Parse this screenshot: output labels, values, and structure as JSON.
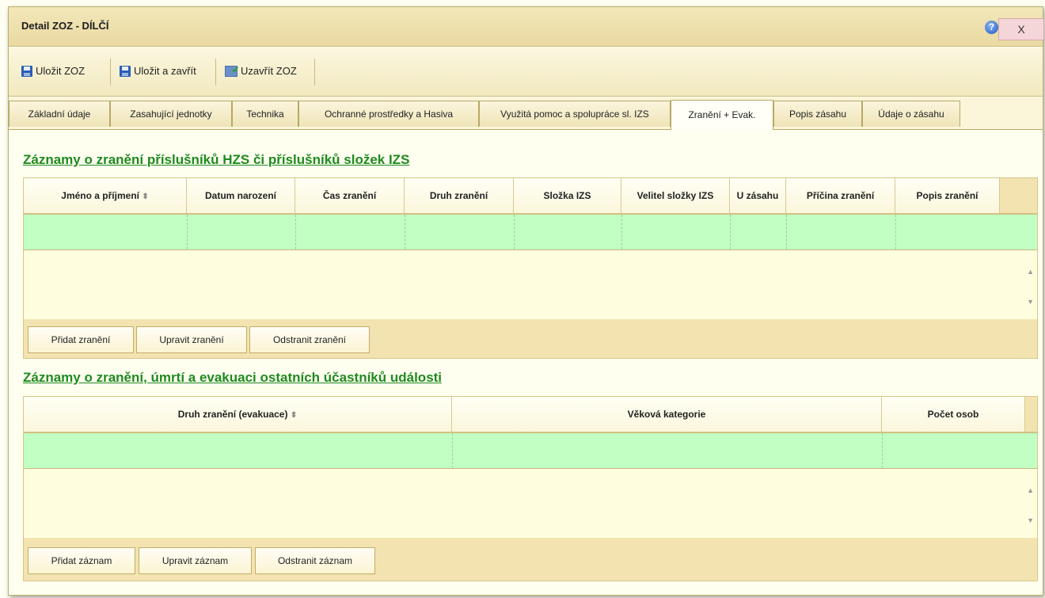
{
  "window": {
    "title": "Detail ZOZ - DÍLČÍ",
    "help_glyph": "?",
    "close_label": "X"
  },
  "toolbar": {
    "save_label": "Uložit ZOZ",
    "save_close_label": "Uložit a zavřít",
    "finish_label": "Uzavřít ZOZ"
  },
  "tabs": [
    {
      "label": "Základní údaje"
    },
    {
      "label": "Zasahující jednotky"
    },
    {
      "label": "Technika"
    },
    {
      "label": "Ochranné prostředky a Hasiva"
    },
    {
      "label": "Využitá pomoc a spolupráce sl. IZS"
    },
    {
      "label": "Zranění + Evak.",
      "active": true
    },
    {
      "label": "Popis zásahu"
    },
    {
      "label": "Údaje o zásahu"
    }
  ],
  "section1": {
    "title": "Záznamy o zranění příslušníků HZS či příslušníků složek IZS",
    "columns": [
      "Jméno a příjmení",
      "Datum narození",
      "Čas zranění",
      "Druh zranění",
      "Složka IZS",
      "Velitel složky IZS",
      "U zásahu",
      "Příčina zranění",
      "Popis zranění"
    ],
    "buttons": {
      "add": "Přidat zranění",
      "edit": "Upravit zranění",
      "remove": "Odstranit zranění"
    }
  },
  "section2": {
    "title": "Záznamy o zranění, úmrtí a evakuaci ostatních účastníků události",
    "columns": [
      "Druh zranění (evakuace)",
      "Věková kategorie",
      "Počet osob"
    ],
    "buttons": {
      "add": "Přidat záznam",
      "edit": "Upravit záznam",
      "remove": "Odstranit záznam"
    }
  },
  "icons": {
    "sort": "⬍",
    "scroll_up": "▲",
    "scroll_down": "▼"
  },
  "colors": {
    "accent_green": "#1f8a1f",
    "row_green": "#c2ffc2",
    "frame": "#f2e3b0"
  }
}
